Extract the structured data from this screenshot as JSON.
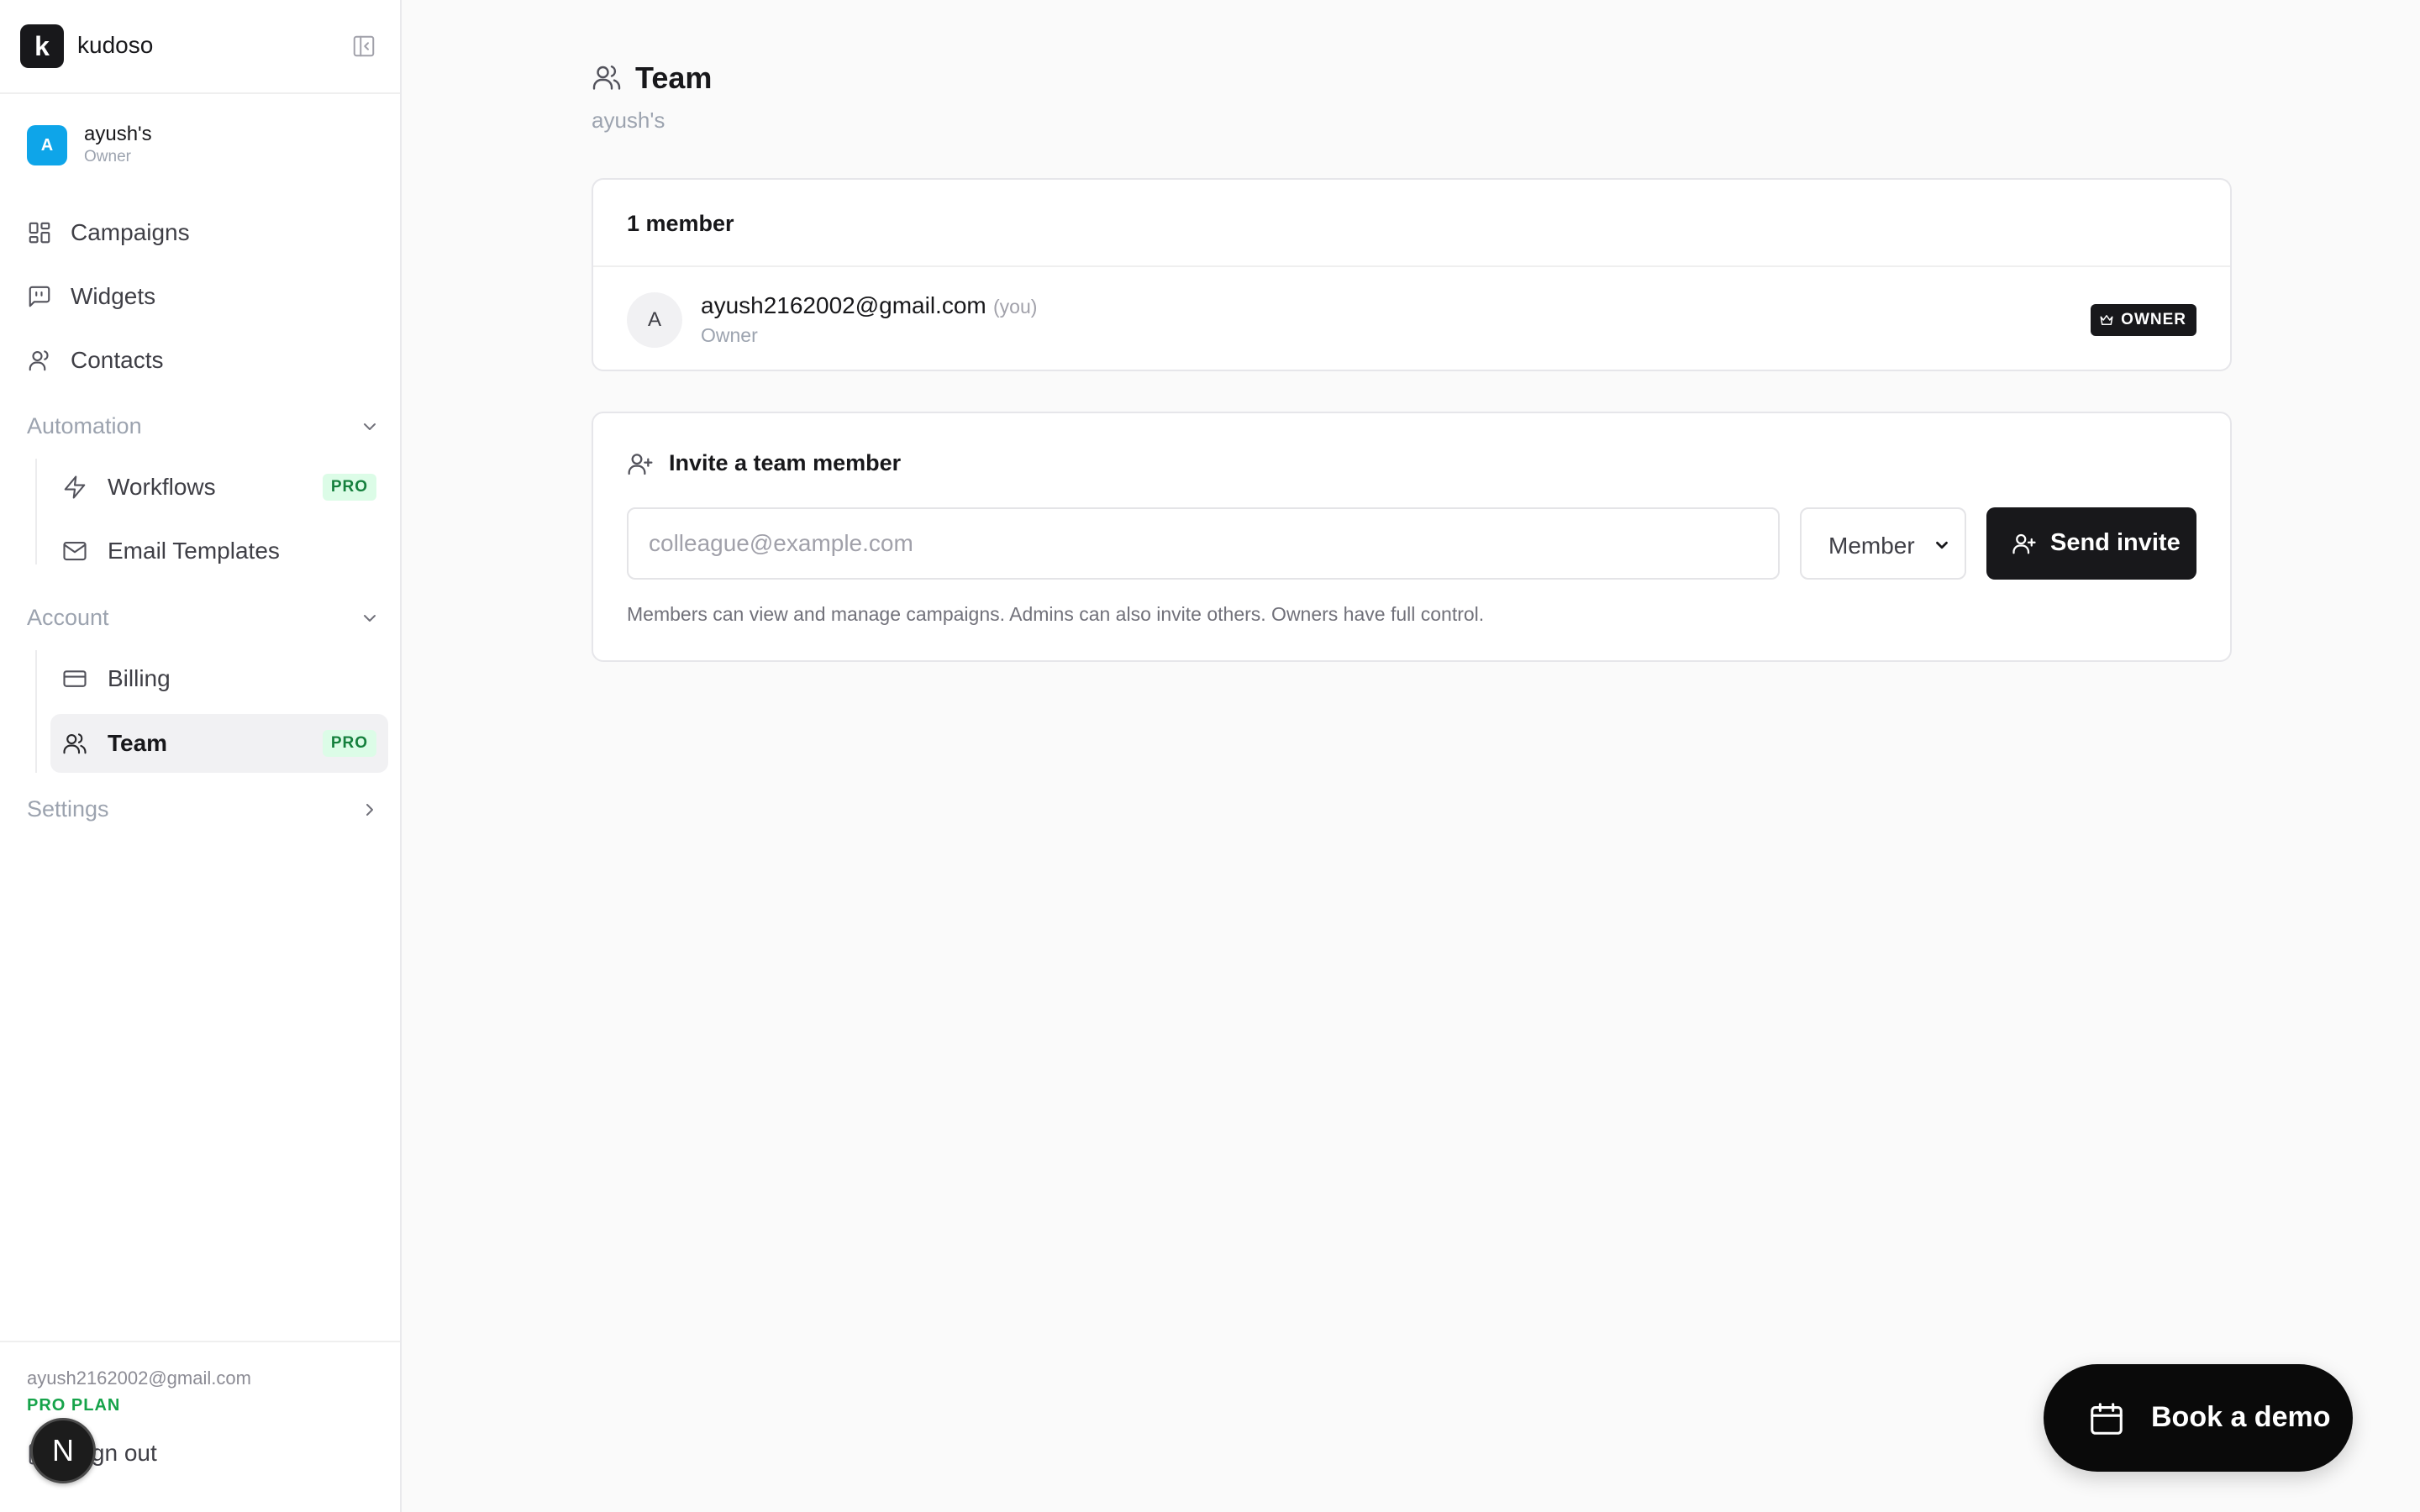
{
  "brand": {
    "logo_letter": "k",
    "name": "kudoso"
  },
  "org": {
    "avatar_letter": "A",
    "name": "ayush's",
    "role": "Owner"
  },
  "nav": {
    "campaigns": "Campaigns",
    "widgets": "Widgets",
    "contacts": "Contacts",
    "automation": {
      "label": "Automation",
      "workflows": "Workflows",
      "workflows_badge": "PRO",
      "email_templates": "Email Templates"
    },
    "account": {
      "label": "Account",
      "billing": "Billing",
      "team": "Team",
      "team_badge": "PRO"
    },
    "settings": "Settings"
  },
  "footer": {
    "email": "ayush2162002@gmail.com",
    "plan": "PRO PLAN",
    "signout": "Sign out",
    "next_badge": "N"
  },
  "page": {
    "title": "Team",
    "subtitle": "ayush's"
  },
  "members": {
    "count_label": "1 member",
    "list": [
      {
        "avatar": "A",
        "email": "ayush2162002@gmail.com",
        "you": "(you)",
        "role": "Owner",
        "badge": "OWNER"
      }
    ]
  },
  "invite": {
    "title": "Invite a team member",
    "email_placeholder": "colleague@example.com",
    "email_value": "",
    "role_value": "Member",
    "send_label": "Send invite",
    "help": "Members can view and manage campaigns. Admins can also invite others. Owners have full control."
  },
  "demo": {
    "label": "Book a demo"
  },
  "colors": {
    "accent": "#18181b",
    "pro_badge_bg": "#dcfce7",
    "pro_badge_text": "#15803d",
    "org_avatar": "#0ea5e9"
  }
}
